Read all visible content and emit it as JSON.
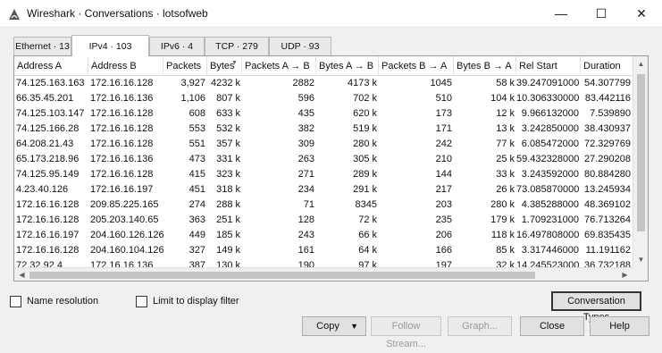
{
  "window": {
    "title": "Wireshark · Conversations · lotsofweb",
    "minimize": "—",
    "maximize": "☐",
    "close": "✕"
  },
  "tabs": [
    {
      "label": "Ethernet · 13"
    },
    {
      "label": "IPv4 · 103"
    },
    {
      "label": "IPv6 · 4"
    },
    {
      "label": "TCP · 279"
    },
    {
      "label": "UDP · 93"
    }
  ],
  "active_tab": "IPv4 · 103",
  "table": {
    "columns": [
      "Address A",
      "Address B",
      "Packets",
      "Bytes",
      "Packets A → B",
      "Bytes A → B",
      "Packets B → A",
      "Bytes B → A",
      "Rel Start",
      "Duration"
    ],
    "sorted_column": "Bytes",
    "rows": [
      [
        "74.125.163.163",
        "172.16.16.128",
        "3,927",
        "4232 k",
        "2882",
        "4173 k",
        "1045",
        "58 k",
        "39.247091000",
        "54.307799"
      ],
      [
        "66.35.45.201",
        "172.16.16.136",
        "1,106",
        "807 k",
        "596",
        "702 k",
        "510",
        "104 k",
        "10.306330000",
        "83.442116"
      ],
      [
        "74.125.103.147",
        "172.16.16.128",
        "608",
        "633 k",
        "435",
        "620 k",
        "173",
        "12 k",
        "9.966132000",
        "7.539890"
      ],
      [
        "74.125.166.28",
        "172.16.16.128",
        "553",
        "532 k",
        "382",
        "519 k",
        "171",
        "13 k",
        "3.242850000",
        "38.430937"
      ],
      [
        "64.208.21.43",
        "172.16.16.128",
        "551",
        "357 k",
        "309",
        "280 k",
        "242",
        "77 k",
        "6.085472000",
        "72.329769"
      ],
      [
        "65.173.218.96",
        "172.16.16.136",
        "473",
        "331 k",
        "263",
        "305 k",
        "210",
        "25 k",
        "59.432328000",
        "27.290208"
      ],
      [
        "74.125.95.149",
        "172.16.16.128",
        "415",
        "323 k",
        "271",
        "289 k",
        "144",
        "33 k",
        "3.243592000",
        "80.884280"
      ],
      [
        "4.23.40.126",
        "172.16.16.197",
        "451",
        "318 k",
        "234",
        "291 k",
        "217",
        "26 k",
        "73.085870000",
        "13.245934"
      ],
      [
        "172.16.16.128",
        "209.85.225.165",
        "274",
        "288 k",
        "71",
        "8345",
        "203",
        "280 k",
        "4.385288000",
        "48.369102"
      ],
      [
        "172.16.16.128",
        "205.203.140.65",
        "363",
        "251 k",
        "128",
        "72 k",
        "235",
        "179 k",
        "1.709231000",
        "76.713264"
      ],
      [
        "172.16.16.197",
        "204.160.126.126",
        "449",
        "185 k",
        "243",
        "66 k",
        "206",
        "118 k",
        "16.497808000",
        "69.835435"
      ],
      [
        "172.16.16.128",
        "204.160.104.126",
        "327",
        "149 k",
        "161",
        "64 k",
        "166",
        "85 k",
        "3.317446000",
        "11.191162"
      ],
      [
        "72.32.92.4",
        "172.16.16.136",
        "387",
        "130 k",
        "190",
        "97 k",
        "197",
        "32 k",
        "14.245523000",
        "36.732188"
      ]
    ]
  },
  "scrollbar": {
    "up": "▲",
    "down": "▼",
    "left": "◀",
    "right": "▶"
  },
  "options": {
    "name_resolution": "Name resolution",
    "limit_to_display_filter": "Limit to display filter"
  },
  "buttons": {
    "conversation_types": "Conversation Types",
    "copy": "Copy",
    "copy_caret": "▼",
    "follow_stream": "Follow Stream...",
    "graph": "Graph...",
    "close": "Close",
    "help": "Help"
  }
}
